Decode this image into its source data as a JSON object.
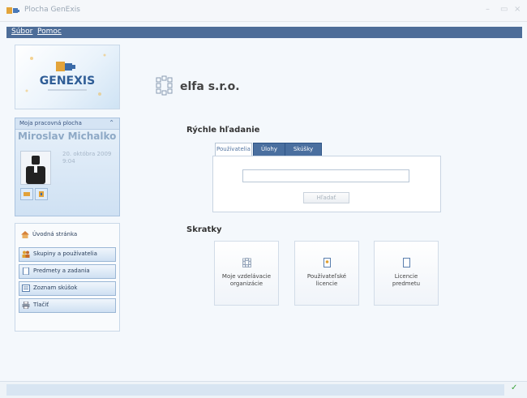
{
  "window": {
    "title": "Plocha GenExis",
    "controls": [
      "–",
      "▭",
      "×"
    ]
  },
  "menu": {
    "items": [
      "Súbor",
      "Pomoc"
    ]
  },
  "sidebar": {
    "logo_text": "GENEXIS",
    "profile": {
      "header_label": "Moja pracovná plocha",
      "user_name": "Miroslav Michalko",
      "login_date": "20. októbra 2009",
      "login_time": "9:04"
    },
    "nav_items": [
      {
        "label": "Úvodná stránka",
        "icon": "home-icon"
      },
      {
        "label": "Skupiny a používatelia",
        "icon": "users-icon"
      },
      {
        "label": "Predmety a zadania",
        "icon": "document-icon"
      },
      {
        "label": "Zoznam skúšok",
        "icon": "list-icon"
      },
      {
        "label": "Tlačiť",
        "icon": "printer-icon"
      }
    ]
  },
  "content": {
    "org_name": "elfa s.r.o.",
    "search": {
      "title": "Rýchle hľadanie",
      "tabs": [
        "Používatelia",
        "Úlohy",
        "Skúšky"
      ],
      "active_tab": "Používatelia",
      "input_value": "",
      "button_label": "Hľadať"
    },
    "shortcuts": {
      "title": "Skratky",
      "tiles": [
        {
          "label": "Moje vzdelávacie\norganizácie",
          "icon": "organization-icon"
        },
        {
          "label": "Používateľské\nlicencie",
          "icon": "license-icon"
        },
        {
          "label": "Licencie\npredmetu",
          "icon": "document-icon"
        }
      ]
    }
  },
  "colors": {
    "menu_bar": "#4d6d98",
    "tab_active": "#4a6f9f",
    "status_ok": "#3aa33a"
  }
}
